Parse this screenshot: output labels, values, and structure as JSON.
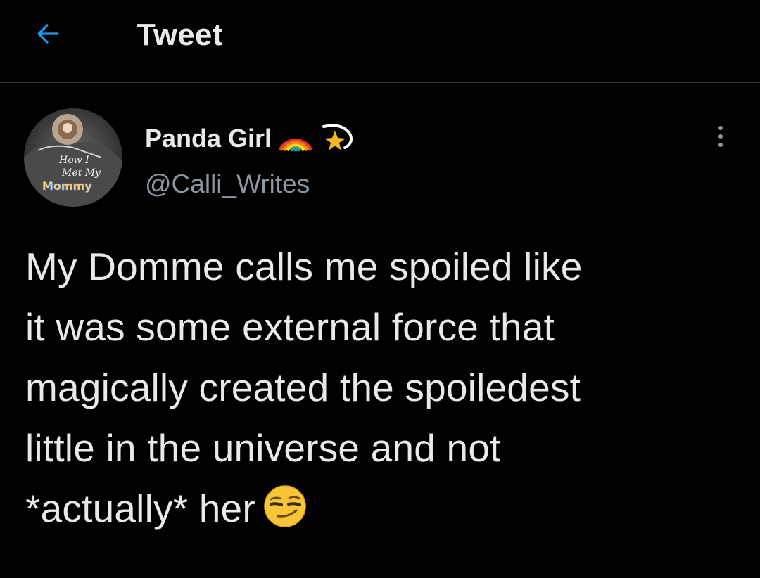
{
  "header": {
    "title": "Tweet",
    "back_icon": "arrow-left-icon",
    "accent_color": "#1d9bf0"
  },
  "author": {
    "display_name": "Panda Girl",
    "handle": "@Calli_Writes",
    "name_emojis": [
      "rainbow-emoji",
      "shooting-star-emoji"
    ],
    "avatar_text": [
      "How I",
      "Met My",
      "Mommy"
    ]
  },
  "tweet": {
    "lines": [
      "My Domme calls me spoiled like",
      "it was some external force that",
      "magically created the spoiledest",
      "little in the universe and not",
      "*actually* her"
    ],
    "trailing_emoji": "smirking-face-emoji"
  },
  "colors": {
    "background": "#000000",
    "text": "#e7e9ea",
    "secondary_text": "#8b98a5",
    "divider": "#2f3336"
  }
}
